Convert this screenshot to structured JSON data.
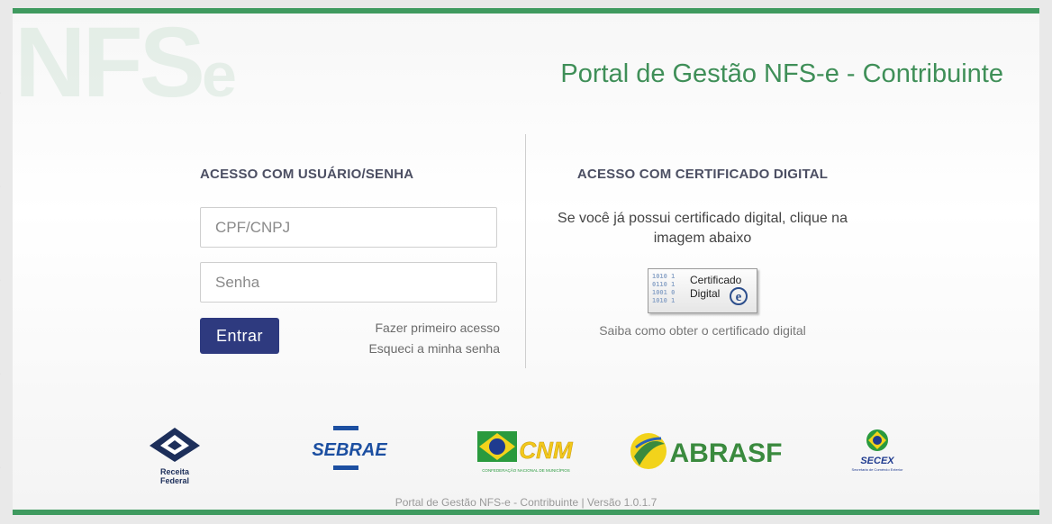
{
  "page": {
    "title": "Portal de Gestão NFS-e - Contribuinte",
    "logo_text": "NFSe"
  },
  "login": {
    "heading": "ACESSO COM USUÁRIO/SENHA",
    "username_placeholder": "CPF/CNPJ",
    "password_placeholder": "Senha",
    "submit_label": "Entrar",
    "first_access_link": "Fazer primeiro acesso",
    "forgot_password_link": "Esqueci a minha senha"
  },
  "certificate": {
    "heading": "ACESSO COM CERTIFICADO DIGITAL",
    "instruction": "Se você já possui certificado digital, clique na imagem abaixo",
    "badge_line1": "Certificado",
    "badge_line2": "Digital",
    "badge_mark": "e",
    "how_to_link": "Saiba como obter o certificado digital"
  },
  "partners": [
    {
      "name": "Receita Federal",
      "icon": "receita-federal-logo"
    },
    {
      "name": "SEBRAE",
      "icon": "sebrae-logo"
    },
    {
      "name": "CNM",
      "caption": "CONFEDERAÇÃO NACIONAL DE MUNICÍPIOS",
      "icon": "cnm-logo"
    },
    {
      "name": "ABRASF",
      "icon": "abrasf-logo"
    },
    {
      "name": "SECEX",
      "caption": "Secretaria de Comércio Exterior",
      "icon": "secex-logo"
    }
  ],
  "footer": {
    "version_text": "Portal de Gestão NFS-e - Contribuinte | Versão 1.0.1.7"
  },
  "colors": {
    "brand_green": "#3f9a5f",
    "button_navy": "#2e3a7f",
    "sebrae_blue": "#1c4fa1",
    "abrasf_green": "#3a8a3e"
  }
}
